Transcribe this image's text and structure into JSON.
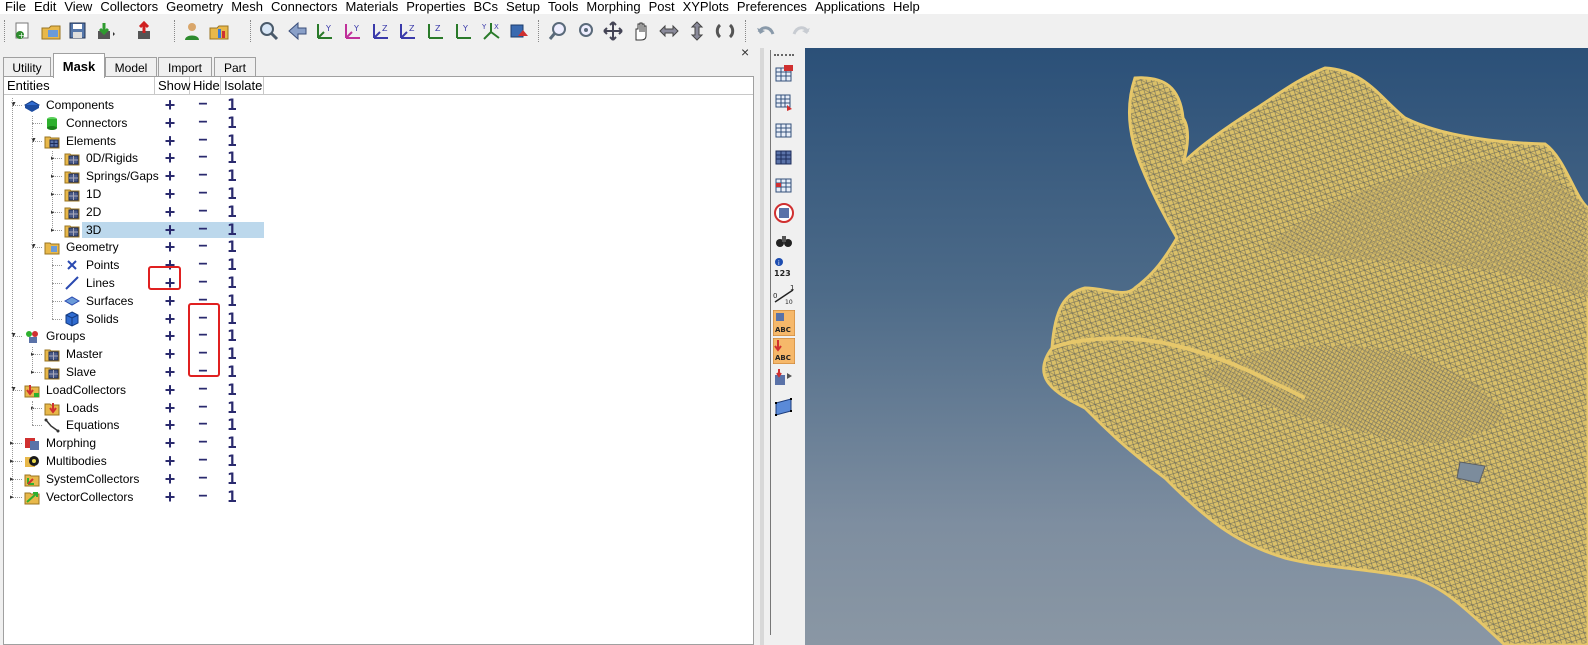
{
  "menu": [
    "File",
    "Edit",
    "View",
    "Collectors",
    "Geometry",
    "Mesh",
    "Connectors",
    "Materials",
    "Properties",
    "BCs",
    "Setup",
    "Tools",
    "Morphing",
    "Post",
    "XYPlots",
    "Preferences",
    "Applications",
    "Help"
  ],
  "panel": {
    "close_glyph": "×",
    "tabs": [
      {
        "label": "Utility",
        "active": false
      },
      {
        "label": "Mask",
        "active": true
      },
      {
        "label": "Model",
        "active": false
      },
      {
        "label": "Import",
        "active": false
      },
      {
        "label": "Part",
        "active": false
      }
    ],
    "columns": {
      "entities": "Entities",
      "show": "Show",
      "hide": "Hide",
      "isolate": "Isolate"
    },
    "action_glyphs": {
      "show": "+",
      "hide": "−",
      "isolate": "1"
    },
    "rows": [
      {
        "label": "Components",
        "icon": "components-icon",
        "level": 0,
        "expanded": true
      },
      {
        "label": "Connectors",
        "icon": "connectors-icon",
        "level": 1
      },
      {
        "label": "Elements",
        "icon": "elements-folder-icon",
        "level": 1,
        "expanded": true
      },
      {
        "label": "0D/Rigids",
        "icon": "element-grid-icon",
        "level": 2
      },
      {
        "label": "Springs/Gaps",
        "icon": "element-grid-icon",
        "level": 2
      },
      {
        "label": "1D",
        "icon": "element-grid-icon",
        "level": 2
      },
      {
        "label": "2D",
        "icon": "element-grid-icon",
        "level": 2
      },
      {
        "label": "3D",
        "icon": "element-grid-icon",
        "level": 2,
        "selected": true
      },
      {
        "label": "Geometry",
        "icon": "geometry-folder-icon",
        "level": 1,
        "expanded": true
      },
      {
        "label": "Points",
        "icon": "points-icon",
        "level": 2
      },
      {
        "label": "Lines",
        "icon": "lines-icon",
        "level": 2
      },
      {
        "label": "Surfaces",
        "icon": "surfaces-icon",
        "level": 2
      },
      {
        "label": "Solids",
        "icon": "solids-icon",
        "level": 2
      },
      {
        "label": "Groups",
        "icon": "groups-icon",
        "level": 0,
        "expanded": true
      },
      {
        "label": "Master",
        "icon": "element-grid-icon",
        "level": 1
      },
      {
        "label": "Slave",
        "icon": "element-grid-icon",
        "level": 1
      },
      {
        "label": "LoadCollectors",
        "icon": "loadcollectors-icon",
        "level": 0,
        "expanded": true
      },
      {
        "label": "Loads",
        "icon": "loads-icon",
        "level": 1
      },
      {
        "label": "Equations",
        "icon": "equations-icon",
        "level": 1
      },
      {
        "label": "Morphing",
        "icon": "morphing-icon",
        "level": 0
      },
      {
        "label": "Multibodies",
        "icon": "multibodies-icon",
        "level": 0
      },
      {
        "label": "SystemCollectors",
        "icon": "systemcollectors-icon",
        "level": 0
      },
      {
        "label": "VectorCollectors",
        "icon": "vectorcollectors-icon",
        "level": 0
      }
    ]
  },
  "sidebar": {
    "items": [
      "display-elements-icon",
      "display-by-collector-icon",
      "display-all-icon",
      "display-wireframe-icon",
      "display-reverse-icon",
      "display-mask-icon",
      "find-binoculars-icon",
      "numbers-icon",
      "scale-icon",
      "label-abc-icon",
      "load-label-abc-icon",
      "transfer-icon",
      "plane-icon"
    ],
    "numbers_label": "123",
    "scale_labels": [
      "0",
      "1",
      "10"
    ],
    "abc_label": "ABC"
  },
  "toolbar": {
    "items": [
      "new-model-icon",
      "open-model-icon",
      "save-model-icon",
      "import-icon",
      "export-icon",
      "user-profile-icon",
      "open-file-icon",
      "zoom-window-icon",
      "previous-view-icon",
      "iso-view-1-icon",
      "iso-view-2-icon",
      "iso-view-3-icon",
      "iso-view-4-icon",
      "top-view-icon",
      "bottom-view-icon",
      "axes-view-icon",
      "perspective-icon",
      "zoom-in-icon",
      "zoom-fit-icon",
      "pan-icon",
      "hand-icon",
      "rotate-left-right-icon",
      "rotate-up-down-icon",
      "spin-icon",
      "undo-icon",
      "redo-icon"
    ]
  },
  "colors": {
    "mesh": "#e6c76a",
    "viewport_top": "#2b5078",
    "viewport_bottom": "#8a97a4",
    "selection": "#bcd8ec",
    "annotation": "#e02020"
  }
}
